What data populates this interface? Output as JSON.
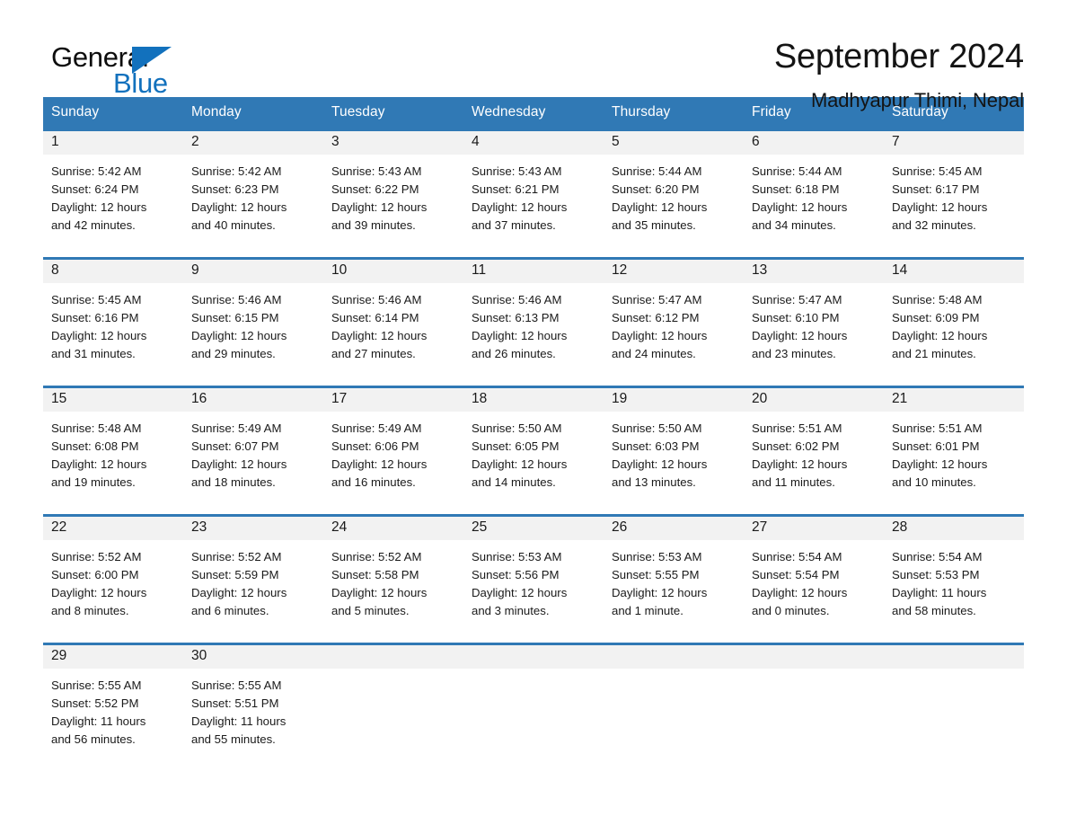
{
  "brand": {
    "name_part1": "General",
    "name_part2": "Blue",
    "triangle_color": "#1271bd",
    "logo_icon": "triangle-flag-icon"
  },
  "header": {
    "title": "September 2024",
    "subtitle": "Madhyapur Thimi, Nepal"
  },
  "theme": {
    "header_blue": "#3079b5",
    "daynum_gray": "#f2f2f2",
    "text": "#1a1a1a"
  },
  "calendar": {
    "weekday_headers": [
      "Sunday",
      "Monday",
      "Tuesday",
      "Wednesday",
      "Thursday",
      "Friday",
      "Saturday"
    ],
    "weeks": [
      [
        {
          "day": "1",
          "sunrise": "Sunrise: 5:42 AM",
          "sunset": "Sunset: 6:24 PM",
          "daylight_line1": "Daylight: 12 hours",
          "daylight_line2": "and 42 minutes."
        },
        {
          "day": "2",
          "sunrise": "Sunrise: 5:42 AM",
          "sunset": "Sunset: 6:23 PM",
          "daylight_line1": "Daylight: 12 hours",
          "daylight_line2": "and 40 minutes."
        },
        {
          "day": "3",
          "sunrise": "Sunrise: 5:43 AM",
          "sunset": "Sunset: 6:22 PM",
          "daylight_line1": "Daylight: 12 hours",
          "daylight_line2": "and 39 minutes."
        },
        {
          "day": "4",
          "sunrise": "Sunrise: 5:43 AM",
          "sunset": "Sunset: 6:21 PM",
          "daylight_line1": "Daylight: 12 hours",
          "daylight_line2": "and 37 minutes."
        },
        {
          "day": "5",
          "sunrise": "Sunrise: 5:44 AM",
          "sunset": "Sunset: 6:20 PM",
          "daylight_line1": "Daylight: 12 hours",
          "daylight_line2": "and 35 minutes."
        },
        {
          "day": "6",
          "sunrise": "Sunrise: 5:44 AM",
          "sunset": "Sunset: 6:18 PM",
          "daylight_line1": "Daylight: 12 hours",
          "daylight_line2": "and 34 minutes."
        },
        {
          "day": "7",
          "sunrise": "Sunrise: 5:45 AM",
          "sunset": "Sunset: 6:17 PM",
          "daylight_line1": "Daylight: 12 hours",
          "daylight_line2": "and 32 minutes."
        }
      ],
      [
        {
          "day": "8",
          "sunrise": "Sunrise: 5:45 AM",
          "sunset": "Sunset: 6:16 PM",
          "daylight_line1": "Daylight: 12 hours",
          "daylight_line2": "and 31 minutes."
        },
        {
          "day": "9",
          "sunrise": "Sunrise: 5:46 AM",
          "sunset": "Sunset: 6:15 PM",
          "daylight_line1": "Daylight: 12 hours",
          "daylight_line2": "and 29 minutes."
        },
        {
          "day": "10",
          "sunrise": "Sunrise: 5:46 AM",
          "sunset": "Sunset: 6:14 PM",
          "daylight_line1": "Daylight: 12 hours",
          "daylight_line2": "and 27 minutes."
        },
        {
          "day": "11",
          "sunrise": "Sunrise: 5:46 AM",
          "sunset": "Sunset: 6:13 PM",
          "daylight_line1": "Daylight: 12 hours",
          "daylight_line2": "and 26 minutes."
        },
        {
          "day": "12",
          "sunrise": "Sunrise: 5:47 AM",
          "sunset": "Sunset: 6:12 PM",
          "daylight_line1": "Daylight: 12 hours",
          "daylight_line2": "and 24 minutes."
        },
        {
          "day": "13",
          "sunrise": "Sunrise: 5:47 AM",
          "sunset": "Sunset: 6:10 PM",
          "daylight_line1": "Daylight: 12 hours",
          "daylight_line2": "and 23 minutes."
        },
        {
          "day": "14",
          "sunrise": "Sunrise: 5:48 AM",
          "sunset": "Sunset: 6:09 PM",
          "daylight_line1": "Daylight: 12 hours",
          "daylight_line2": "and 21 minutes."
        }
      ],
      [
        {
          "day": "15",
          "sunrise": "Sunrise: 5:48 AM",
          "sunset": "Sunset: 6:08 PM",
          "daylight_line1": "Daylight: 12 hours",
          "daylight_line2": "and 19 minutes."
        },
        {
          "day": "16",
          "sunrise": "Sunrise: 5:49 AM",
          "sunset": "Sunset: 6:07 PM",
          "daylight_line1": "Daylight: 12 hours",
          "daylight_line2": "and 18 minutes."
        },
        {
          "day": "17",
          "sunrise": "Sunrise: 5:49 AM",
          "sunset": "Sunset: 6:06 PM",
          "daylight_line1": "Daylight: 12 hours",
          "daylight_line2": "and 16 minutes."
        },
        {
          "day": "18",
          "sunrise": "Sunrise: 5:50 AM",
          "sunset": "Sunset: 6:05 PM",
          "daylight_line1": "Daylight: 12 hours",
          "daylight_line2": "and 14 minutes."
        },
        {
          "day": "19",
          "sunrise": "Sunrise: 5:50 AM",
          "sunset": "Sunset: 6:03 PM",
          "daylight_line1": "Daylight: 12 hours",
          "daylight_line2": "and 13 minutes."
        },
        {
          "day": "20",
          "sunrise": "Sunrise: 5:51 AM",
          "sunset": "Sunset: 6:02 PM",
          "daylight_line1": "Daylight: 12 hours",
          "daylight_line2": "and 11 minutes."
        },
        {
          "day": "21",
          "sunrise": "Sunrise: 5:51 AM",
          "sunset": "Sunset: 6:01 PM",
          "daylight_line1": "Daylight: 12 hours",
          "daylight_line2": "and 10 minutes."
        }
      ],
      [
        {
          "day": "22",
          "sunrise": "Sunrise: 5:52 AM",
          "sunset": "Sunset: 6:00 PM",
          "daylight_line1": "Daylight: 12 hours",
          "daylight_line2": "and 8 minutes."
        },
        {
          "day": "23",
          "sunrise": "Sunrise: 5:52 AM",
          "sunset": "Sunset: 5:59 PM",
          "daylight_line1": "Daylight: 12 hours",
          "daylight_line2": "and 6 minutes."
        },
        {
          "day": "24",
          "sunrise": "Sunrise: 5:52 AM",
          "sunset": "Sunset: 5:58 PM",
          "daylight_line1": "Daylight: 12 hours",
          "daylight_line2": "and 5 minutes."
        },
        {
          "day": "25",
          "sunrise": "Sunrise: 5:53 AM",
          "sunset": "Sunset: 5:56 PM",
          "daylight_line1": "Daylight: 12 hours",
          "daylight_line2": "and 3 minutes."
        },
        {
          "day": "26",
          "sunrise": "Sunrise: 5:53 AM",
          "sunset": "Sunset: 5:55 PM",
          "daylight_line1": "Daylight: 12 hours",
          "daylight_line2": "and 1 minute."
        },
        {
          "day": "27",
          "sunrise": "Sunrise: 5:54 AM",
          "sunset": "Sunset: 5:54 PM",
          "daylight_line1": "Daylight: 12 hours",
          "daylight_line2": "and 0 minutes."
        },
        {
          "day": "28",
          "sunrise": "Sunrise: 5:54 AM",
          "sunset": "Sunset: 5:53 PM",
          "daylight_line1": "Daylight: 11 hours",
          "daylight_line2": "and 58 minutes."
        }
      ],
      [
        {
          "day": "29",
          "sunrise": "Sunrise: 5:55 AM",
          "sunset": "Sunset: 5:52 PM",
          "daylight_line1": "Daylight: 11 hours",
          "daylight_line2": "and 56 minutes."
        },
        {
          "day": "30",
          "sunrise": "Sunrise: 5:55 AM",
          "sunset": "Sunset: 5:51 PM",
          "daylight_line1": "Daylight: 11 hours",
          "daylight_line2": "and 55 minutes."
        },
        {
          "day": "",
          "sunrise": "",
          "sunset": "",
          "daylight_line1": "",
          "daylight_line2": ""
        },
        {
          "day": "",
          "sunrise": "",
          "sunset": "",
          "daylight_line1": "",
          "daylight_line2": ""
        },
        {
          "day": "",
          "sunrise": "",
          "sunset": "",
          "daylight_line1": "",
          "daylight_line2": ""
        },
        {
          "day": "",
          "sunrise": "",
          "sunset": "",
          "daylight_line1": "",
          "daylight_line2": ""
        },
        {
          "day": "",
          "sunrise": "",
          "sunset": "",
          "daylight_line1": "",
          "daylight_line2": ""
        }
      ]
    ]
  }
}
